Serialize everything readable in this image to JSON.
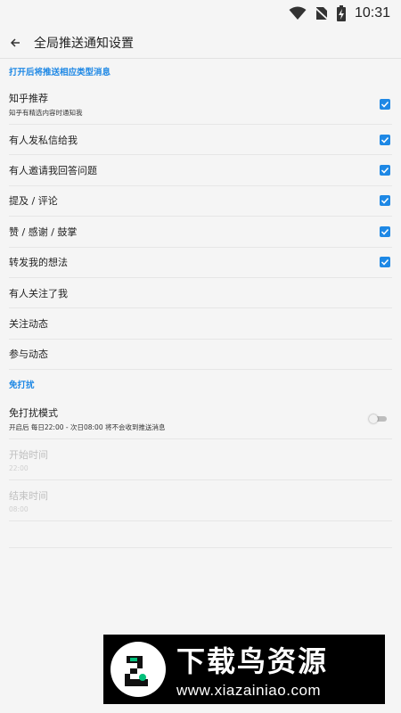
{
  "status_bar": {
    "time": "10:31",
    "icons": [
      "wifi-icon",
      "no-sim-icon",
      "battery-charging-icon"
    ]
  },
  "app_bar": {
    "title": "全局推送通知设置",
    "back_icon": "back-arrow-icon"
  },
  "section_notify": {
    "header": "打开后将推送相应类型消息",
    "items": [
      {
        "label": "知乎推荐",
        "sublabel": "知乎有精选内容时通知我",
        "checked": true
      },
      {
        "label": "有人发私信给我",
        "checked": true
      },
      {
        "label": "有人邀请我回答问题",
        "checked": true
      },
      {
        "label": "提及 / 评论",
        "checked": true
      },
      {
        "label": "赞 / 感谢 / 鼓掌",
        "checked": true
      },
      {
        "label": "转发我的想法",
        "checked": true
      },
      {
        "label": "有人关注了我",
        "checked": false
      },
      {
        "label": "关注动态",
        "checked": false
      },
      {
        "label": "参与动态",
        "checked": false
      }
    ]
  },
  "section_dnd": {
    "header": "免打扰",
    "mode": {
      "label": "免打扰模式",
      "sublabel": "开启后 每日22:00 - 次日08:00 将不会收到推送消息",
      "enabled": false
    },
    "start": {
      "label": "开始时间",
      "value": "22:00"
    },
    "end": {
      "label": "结束时间",
      "value": "08:00"
    }
  },
  "watermark": {
    "title": "下载鸟资源",
    "url": "www.xiazainiao.com"
  },
  "colors": {
    "accent": "#1e88e5",
    "background": "#f5f5f5"
  }
}
